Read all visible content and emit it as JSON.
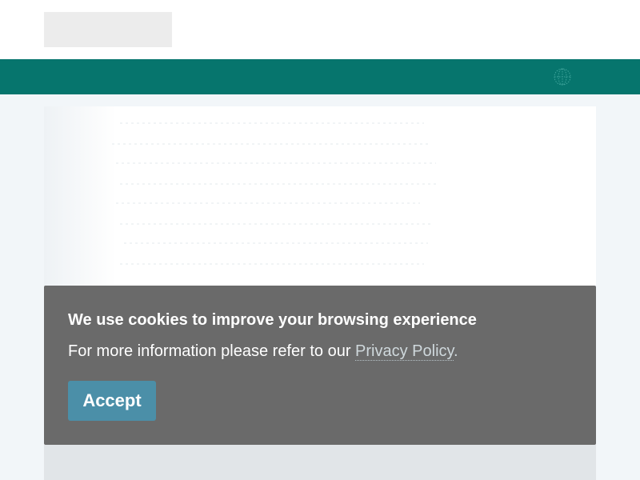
{
  "cookie_banner": {
    "title": "We use cookies to improve your browsing experience",
    "text_prefix": "For more information please refer to our ",
    "privacy_link_label": "Privacy Policy",
    "text_suffix": ".",
    "accept_label": "Accept"
  },
  "colors": {
    "navbar": "#06756d",
    "banner_bg": "#6a6a6a",
    "accept_button": "#4b8fa8"
  },
  "icons": {
    "language_selector": "globe-icon"
  }
}
